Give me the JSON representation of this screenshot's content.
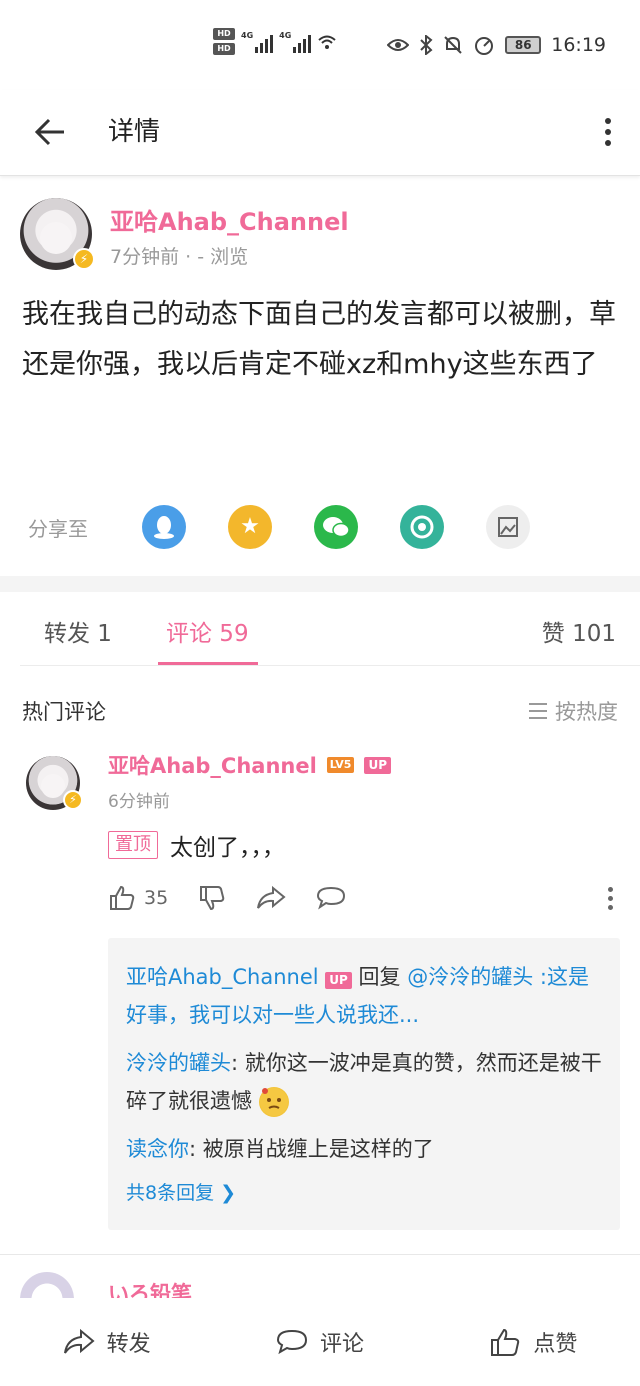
{
  "status_bar": {
    "hd1": "HD",
    "hd2": "HD",
    "net1": "4G",
    "net2": "4G",
    "battery": "86",
    "time": "16:19"
  },
  "header": {
    "title": "详情"
  },
  "post": {
    "author": "亚哈Ahab_Channel",
    "meta": "7分钟前 · - 浏览",
    "content_lines": [
      "我在我自己的动态下面自己的发言都可以被删，草",
      "还是你强，我以后肯定不碰xz和mhy这些东西了"
    ],
    "share_label": "分享至",
    "share_targets": [
      "qq-icon",
      "qzone-icon",
      "wechat-icon",
      "moments-icon",
      "save-image-icon"
    ]
  },
  "tabs": {
    "forward": "转发 1",
    "comment": "评论 59",
    "like": "赞 101"
  },
  "hot_comments": {
    "title": "热门评论",
    "sort_label": "按热度"
  },
  "comment": {
    "author": "亚哈Ahab_Channel",
    "level": "LV5",
    "up_badge": "UP",
    "time": "6分钟前",
    "pinned": "置顶",
    "text": "太创了，，，",
    "like_count": "35",
    "replies": {
      "r1_name": "亚哈Ahab_Channel",
      "r1_badge": "UP",
      "r1_verb": " 回复 ",
      "r1_mention": "@泠泠的罐头",
      "r1_text": ":这是好事，我可以对一些人说我还...",
      "r2_name": "泠泠的罐头",
      "r2_text": ": 就你这一波冲是真的赞，然而还是被干碎了就很遗憾",
      "r3_name": "读念你",
      "r3_text": ": 被原肖战缠上是这样的了",
      "more": "共8条回复"
    }
  },
  "next_comment": {
    "author": "いろ铅笔"
  },
  "bottom_bar": {
    "forward": "转发",
    "comment": "评论",
    "like": "点赞"
  },
  "colors": {
    "brand_pink": "#f06a98",
    "link_blue": "#1e8ad6",
    "level_orange": "#f08a2c"
  }
}
